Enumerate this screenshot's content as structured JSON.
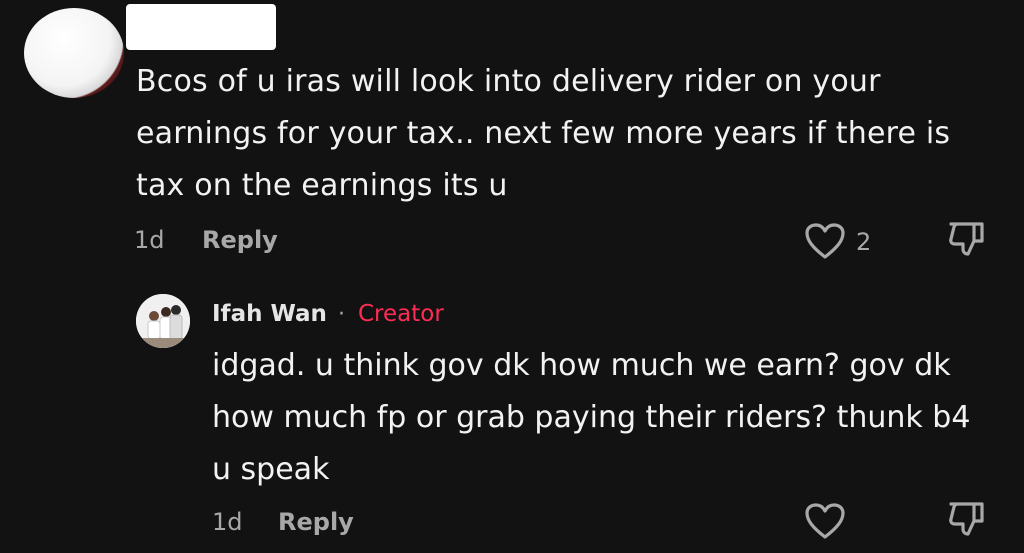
{
  "comment": {
    "text": "Bcos of u iras will look into delivery rider on your earnings for your tax.. next few more years if there is tax on the earnings its u",
    "time": "1d",
    "reply_label": "Reply",
    "like_count": "2"
  },
  "reply": {
    "username": "Ifah Wan",
    "separator": "·",
    "badge": "Creator",
    "text": "idgad. u think gov dk how much we earn? gov dk how much fp or grab paying their riders? thunk b4 u speak",
    "time": "1d",
    "reply_label": "Reply"
  },
  "colors": {
    "background": "#121212",
    "creator_badge": "#fe2c55",
    "muted": "#a8a8a8"
  },
  "icons": [
    "heart-icon",
    "dislike-icon"
  ]
}
